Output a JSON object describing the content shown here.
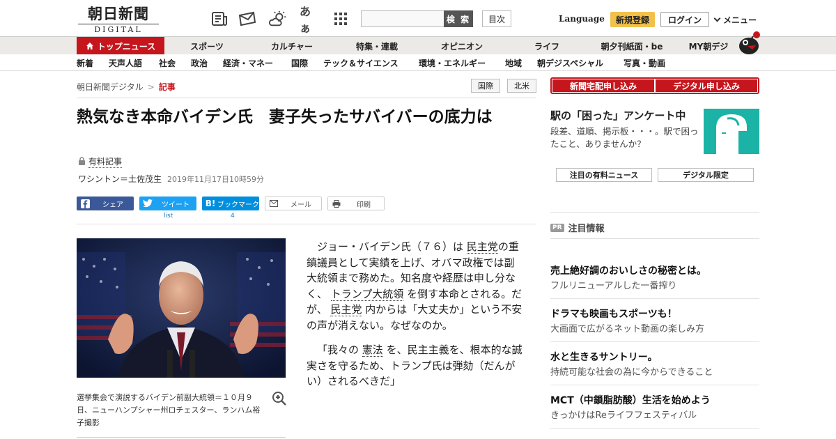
{
  "header": {
    "logo_jp": "朝日新聞",
    "logo_sub": "DIGITAL",
    "search_button": "検 索",
    "toc_button": "目次",
    "language": "Language",
    "register": "新規登録",
    "login": "ログイン",
    "menu": "メニュー",
    "tool_icons": [
      "newspaper-icon",
      "mail-icon",
      "weather-icon",
      "font-size-icon",
      "grid-icon"
    ],
    "font_size_glyph": "あぁ"
  },
  "nav_primary": [
    "トップニュース",
    "スポーツ",
    "カルチャー",
    "特集・連載",
    "オピニオン",
    "ライフ",
    "朝夕刊紙面・be",
    "MY朝デジ"
  ],
  "nav_secondary": [
    "新着",
    "天声人語",
    "社会",
    "政治",
    "経済・マネー",
    "国際",
    "テック＆サイエンス",
    "環境・エネルギー",
    "地域",
    "朝デジスペシャル",
    "写真・動画"
  ],
  "breadcrumb": {
    "home": "朝日新聞デジタル",
    "current": "記事",
    "sep": ">"
  },
  "tags": [
    "国際",
    "北米"
  ],
  "article": {
    "title": "熱気なき本命バイデン氏　妻子失ったサバイバーの底力は",
    "paid_label": "有料記事",
    "author": "ワシントン＝土佐茂生",
    "date": "2019年11月17日10時59分",
    "share": {
      "facebook": "シェア",
      "twitter": "ツイート",
      "hatena": "ブックマーク",
      "mail": "メール",
      "print": "印刷",
      "twitter_count": "list",
      "hatena_count": "4"
    },
    "photo_caption": "選挙集会で演説するバイデン前副大統領＝１０月９日、ニューハンプシャー州ロチェスター、ランハム裕子撮影",
    "p1": {
      "a": "ジョー・バイデン氏（７６）は",
      "l1": "民主党",
      "b": "の重鎮議員として実績を上げ、オバマ政権では副大統領まで務めた。知名度や経歴は申し分なく、",
      "l2": "トランプ大統領",
      "c": "を倒す本命とされる。だが、",
      "l3": "民主党",
      "d": "内からは「大丈夫か」という不安の声が消えない。なぜなのか。"
    },
    "p2": {
      "a": "「我々の",
      "l1": "憲法",
      "b": "を、民主主義を、根本的な誠実さを守るため、トランプ氏は弾劾（だんがい）されるべきだ」"
    }
  },
  "sidebar": {
    "subscribe_paper": "新聞宅配申し込み",
    "subscribe_digital": "デジタル申し込み",
    "survey_title": "駅の「困った」アンケート中",
    "survey_text": "段差、道順、掲示板・・・。駅で困ったこと、ありませんか？",
    "btn_paid_news": "注目の有料ニュース",
    "btn_digital_only": "デジタル限定",
    "pr_badge": "PR",
    "pr_title": "注目情報",
    "ads": [
      {
        "title": "売上絶好調のおいしさの秘密とは。",
        "text": "フルリニューアルした一番搾り"
      },
      {
        "title": "ドラマも映画もスポーツも！",
        "text": "大画面で広がるネット動画の楽しみ方"
      },
      {
        "title": "水と生きるサントリー。",
        "text": "持続可能な社会の為に今からできること"
      },
      {
        "title": "MCT（中鎖脂肪酸）生活を始めよう",
        "text": "きっかけはReライフフェスティバル"
      }
    ]
  },
  "colors": {
    "brand_red": "#c5161d",
    "register_yellow": "#f2c14a",
    "facebook": "#3b5998",
    "twitter": "#1da1f2",
    "hatena": "#008fde",
    "survey_teal": "#1bb3a5"
  }
}
